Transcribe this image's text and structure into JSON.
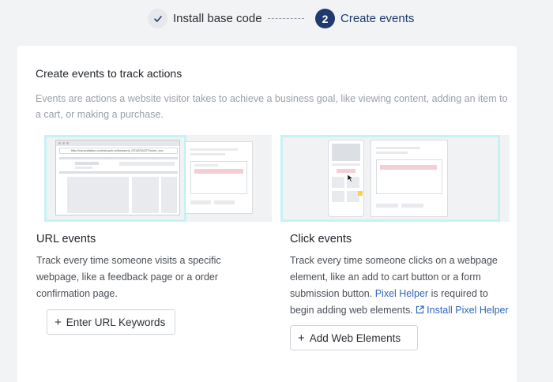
{
  "stepper": {
    "step1": {
      "label": "Install base code",
      "state": "completed",
      "icon": "check-icon"
    },
    "step2": {
      "label": "Create events",
      "number": "2",
      "state": "active"
    }
  },
  "card": {
    "title": "Create events to track actions",
    "description": "Events are actions a website visitor takes to achieve a business goal, like viewing content, adding an item to a cart, or making a purchase."
  },
  "url_events": {
    "illustration_url_text": "http://consultation.com/shopin.xx/keyword_CELBT#2ZT/color_xxx",
    "title": "URL events",
    "description": "Track every time someone visits a specific webpage, like a feedback page or a order confirmation page.",
    "button_label": "Enter URL Keywords"
  },
  "click_events": {
    "title": "Click events",
    "description_part1": "Track every time someone clicks on a webpage element, like an add to cart button or a form submission button. ",
    "pixel_helper_link": "Pixel Helper",
    "description_part2": " is required to begin adding web elements.",
    "install_link": "Install Pixel Helper",
    "button_label": "Add Web Elements"
  },
  "colors": {
    "accent": "#1e3a6e",
    "link": "#2f64b8",
    "highlight": "#c7f2f5",
    "pink": "#f5cdd4"
  }
}
